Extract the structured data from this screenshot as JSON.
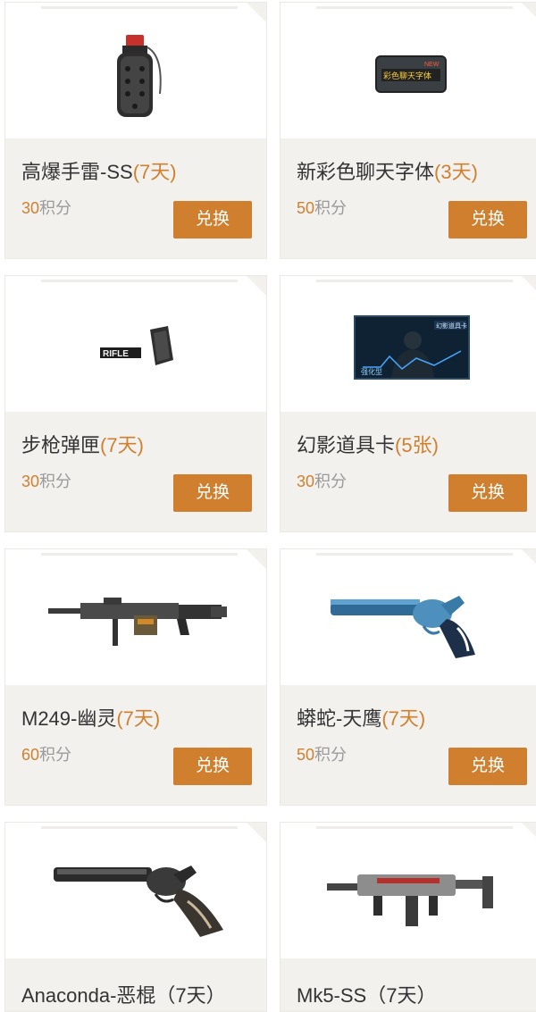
{
  "items": [
    {
      "name": "高爆手雷-SS",
      "tag": "(7天)",
      "points": "30",
      "points_unit": "积分",
      "button": "兑换",
      "icon": "grenade-icon"
    },
    {
      "name": "新彩色聊天字体",
      "tag": "(3天)",
      "points": "50",
      "points_unit": "积分",
      "button": "兑换",
      "icon": "chat-font-card-icon"
    },
    {
      "name": "步枪弹匣",
      "tag": "(7天)",
      "points": "30",
      "points_unit": "积分",
      "button": "兑换",
      "icon": "rifle-magazine-icon"
    },
    {
      "name": "幻影道具卡",
      "tag": "(5张)",
      "points": "30",
      "points_unit": "积分",
      "button": "兑换",
      "icon": "phantom-card-icon"
    },
    {
      "name": "M249-幽灵",
      "tag": "(7天)",
      "points": "60",
      "points_unit": "积分",
      "button": "兑换",
      "icon": "machine-gun-icon"
    },
    {
      "name": "蟒蛇-天鹰",
      "tag": "(7天)",
      "points": "50",
      "points_unit": "积分",
      "button": "兑换",
      "icon": "blue-revolver-icon"
    },
    {
      "name": "Anaconda-恶棍（7天）",
      "tag": "",
      "icon": "revolver-icon"
    },
    {
      "name": "Mk5-SS（7天）",
      "tag": "",
      "icon": "smg-icon"
    }
  ],
  "illustration_text": {
    "chat_font_badge": "NEW",
    "chat_font_text": "彩色聊天字体",
    "rifle_label": "RIFLE",
    "phantom_title": "幻影道具卡",
    "phantom_subtitle": "强化型"
  },
  "colors": {
    "accent": "#cf7f2e",
    "tag_text": "#d0802e",
    "card_bg": "#f2f1ee",
    "points_text": "#9a9a9a"
  }
}
